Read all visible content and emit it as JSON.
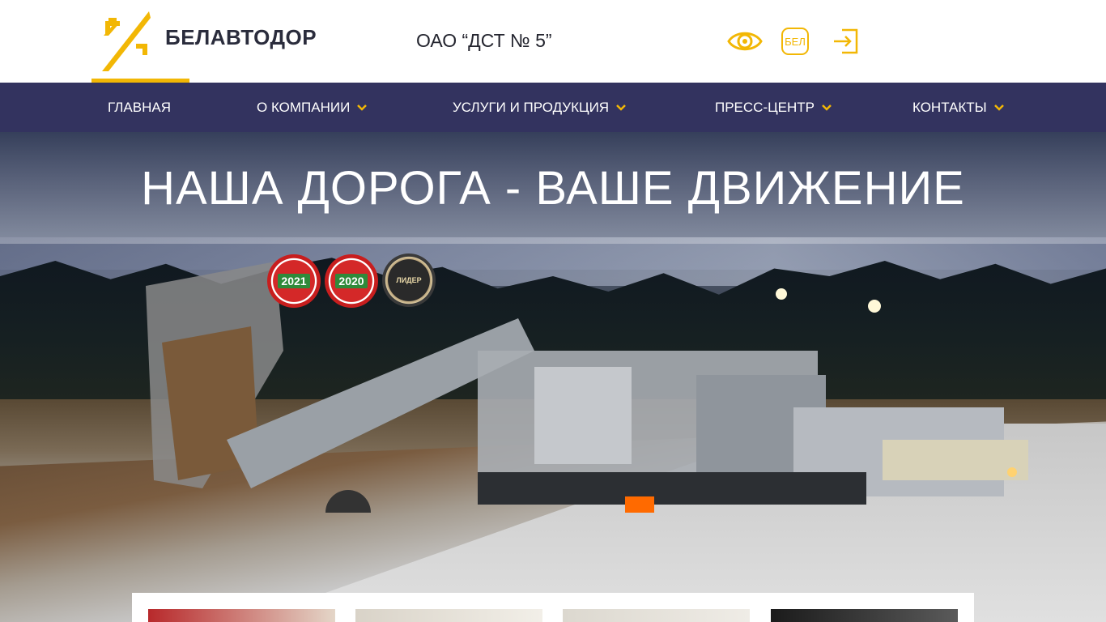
{
  "header": {
    "brand": "БЕЛАВТОДОР",
    "company": "ОАО “ДСТ № 5”",
    "lang_label": "БЕЛ",
    "icons": [
      "vision-icon",
      "language-icon",
      "login-icon"
    ],
    "accent_color": "#f2b705"
  },
  "nav": {
    "items": [
      {
        "label": "ГЛАВНАЯ",
        "active": true
      },
      {
        "label": "О КОМПАНИИ",
        "dropdown": true
      },
      {
        "label": "УСЛУГИ И ПРОДУКЦИЯ",
        "dropdown": true
      },
      {
        "label": "ПРЕСС-ЦЕНТР",
        "dropdown": true
      },
      {
        "label": "КОНТАКТЫ",
        "dropdown": true
      }
    ],
    "background_color": "#33335f"
  },
  "hero": {
    "headline": "НАША ДОРОГА - ВАШЕ ДВИЖЕНИЕ",
    "badges": [
      {
        "year": "2021"
      },
      {
        "year": "2020"
      },
      {
        "label": "ЛИДЕР"
      }
    ]
  }
}
